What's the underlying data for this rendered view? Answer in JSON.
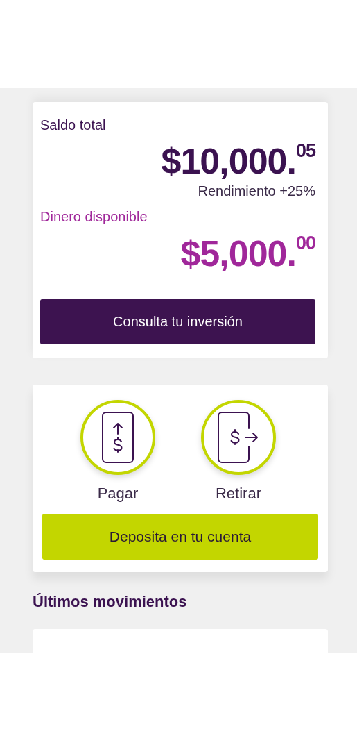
{
  "balance": {
    "total_label": "Saldo total",
    "total_amount": "$10,000.$^{05}$",
    "yield": "Rendimiento +25%",
    "available_label": "Dinero disponible",
    "available_amount": "$5,000.$^{00}$",
    "button": "Consulta tu inversión"
  },
  "actions": {
    "items": [
      {
        "kind": "pay",
        "label": "Pagar"
      },
      {
        "kind": "withdraw",
        "label": "Retirar"
      }
    ],
    "button": "Deposita en tu cuenta"
  },
  "movements": {
    "title": "Últimos movimientos"
  }
}
